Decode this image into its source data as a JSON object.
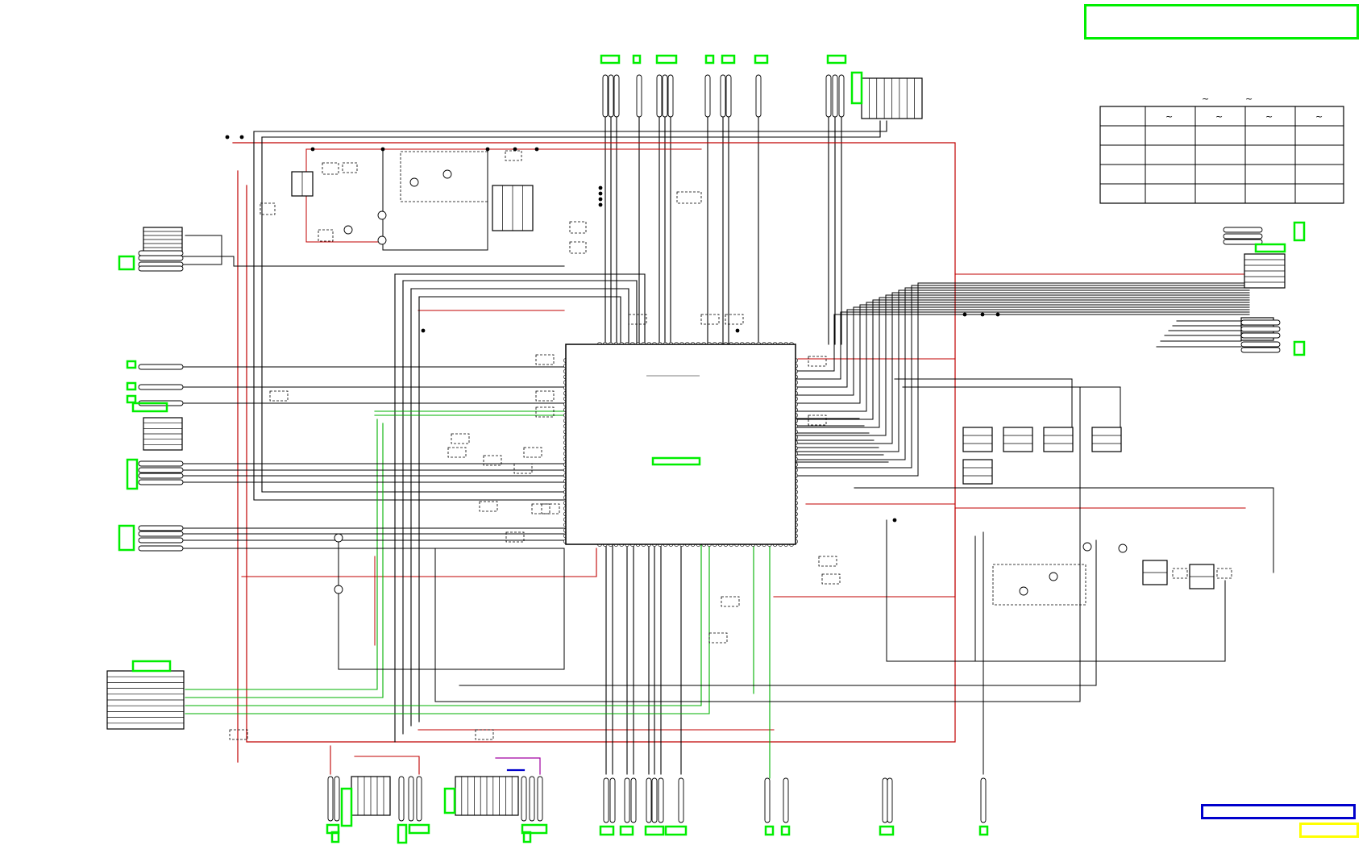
{
  "diagram": {
    "type": "electrical-schematic",
    "background": "#ffffff",
    "colors": {
      "wire": "#000000",
      "power_wire": "#c00000",
      "signal_wire": "#00b000",
      "highlight_green": "#00ee00",
      "highlight_blue": "#0000cc",
      "highlight_yellow": "#ffff00",
      "aux_wire": "#a000a0"
    },
    "title_box": {
      "color": "#00ee00",
      "text": ""
    },
    "legend_box_blue": {
      "color": "#0000cc",
      "text": ""
    },
    "legend_box_yellow": {
      "color": "#ffff00",
      "text": ""
    },
    "table": {
      "rows": 5,
      "cols": 5,
      "header_range_marks": [
        "~",
        "~"
      ],
      "column_marks": [
        "",
        "~",
        "~",
        "~",
        "~"
      ]
    }
  }
}
